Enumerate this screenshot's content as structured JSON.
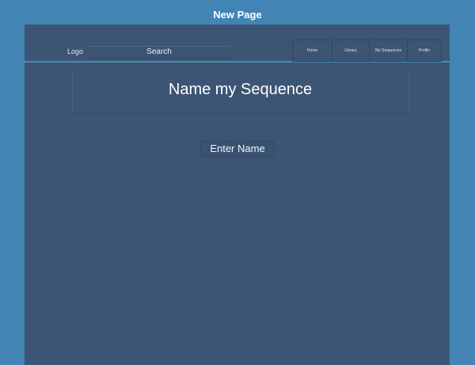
{
  "window": {
    "title": "New Page"
  },
  "header": {
    "logo": "Logo",
    "search_placeholder": "Search",
    "nav": [
      "Home",
      "Library",
      "My Sequences",
      "Profile"
    ]
  },
  "main": {
    "heading": "Name my Sequence",
    "name_input_label": "Enter Name"
  }
}
